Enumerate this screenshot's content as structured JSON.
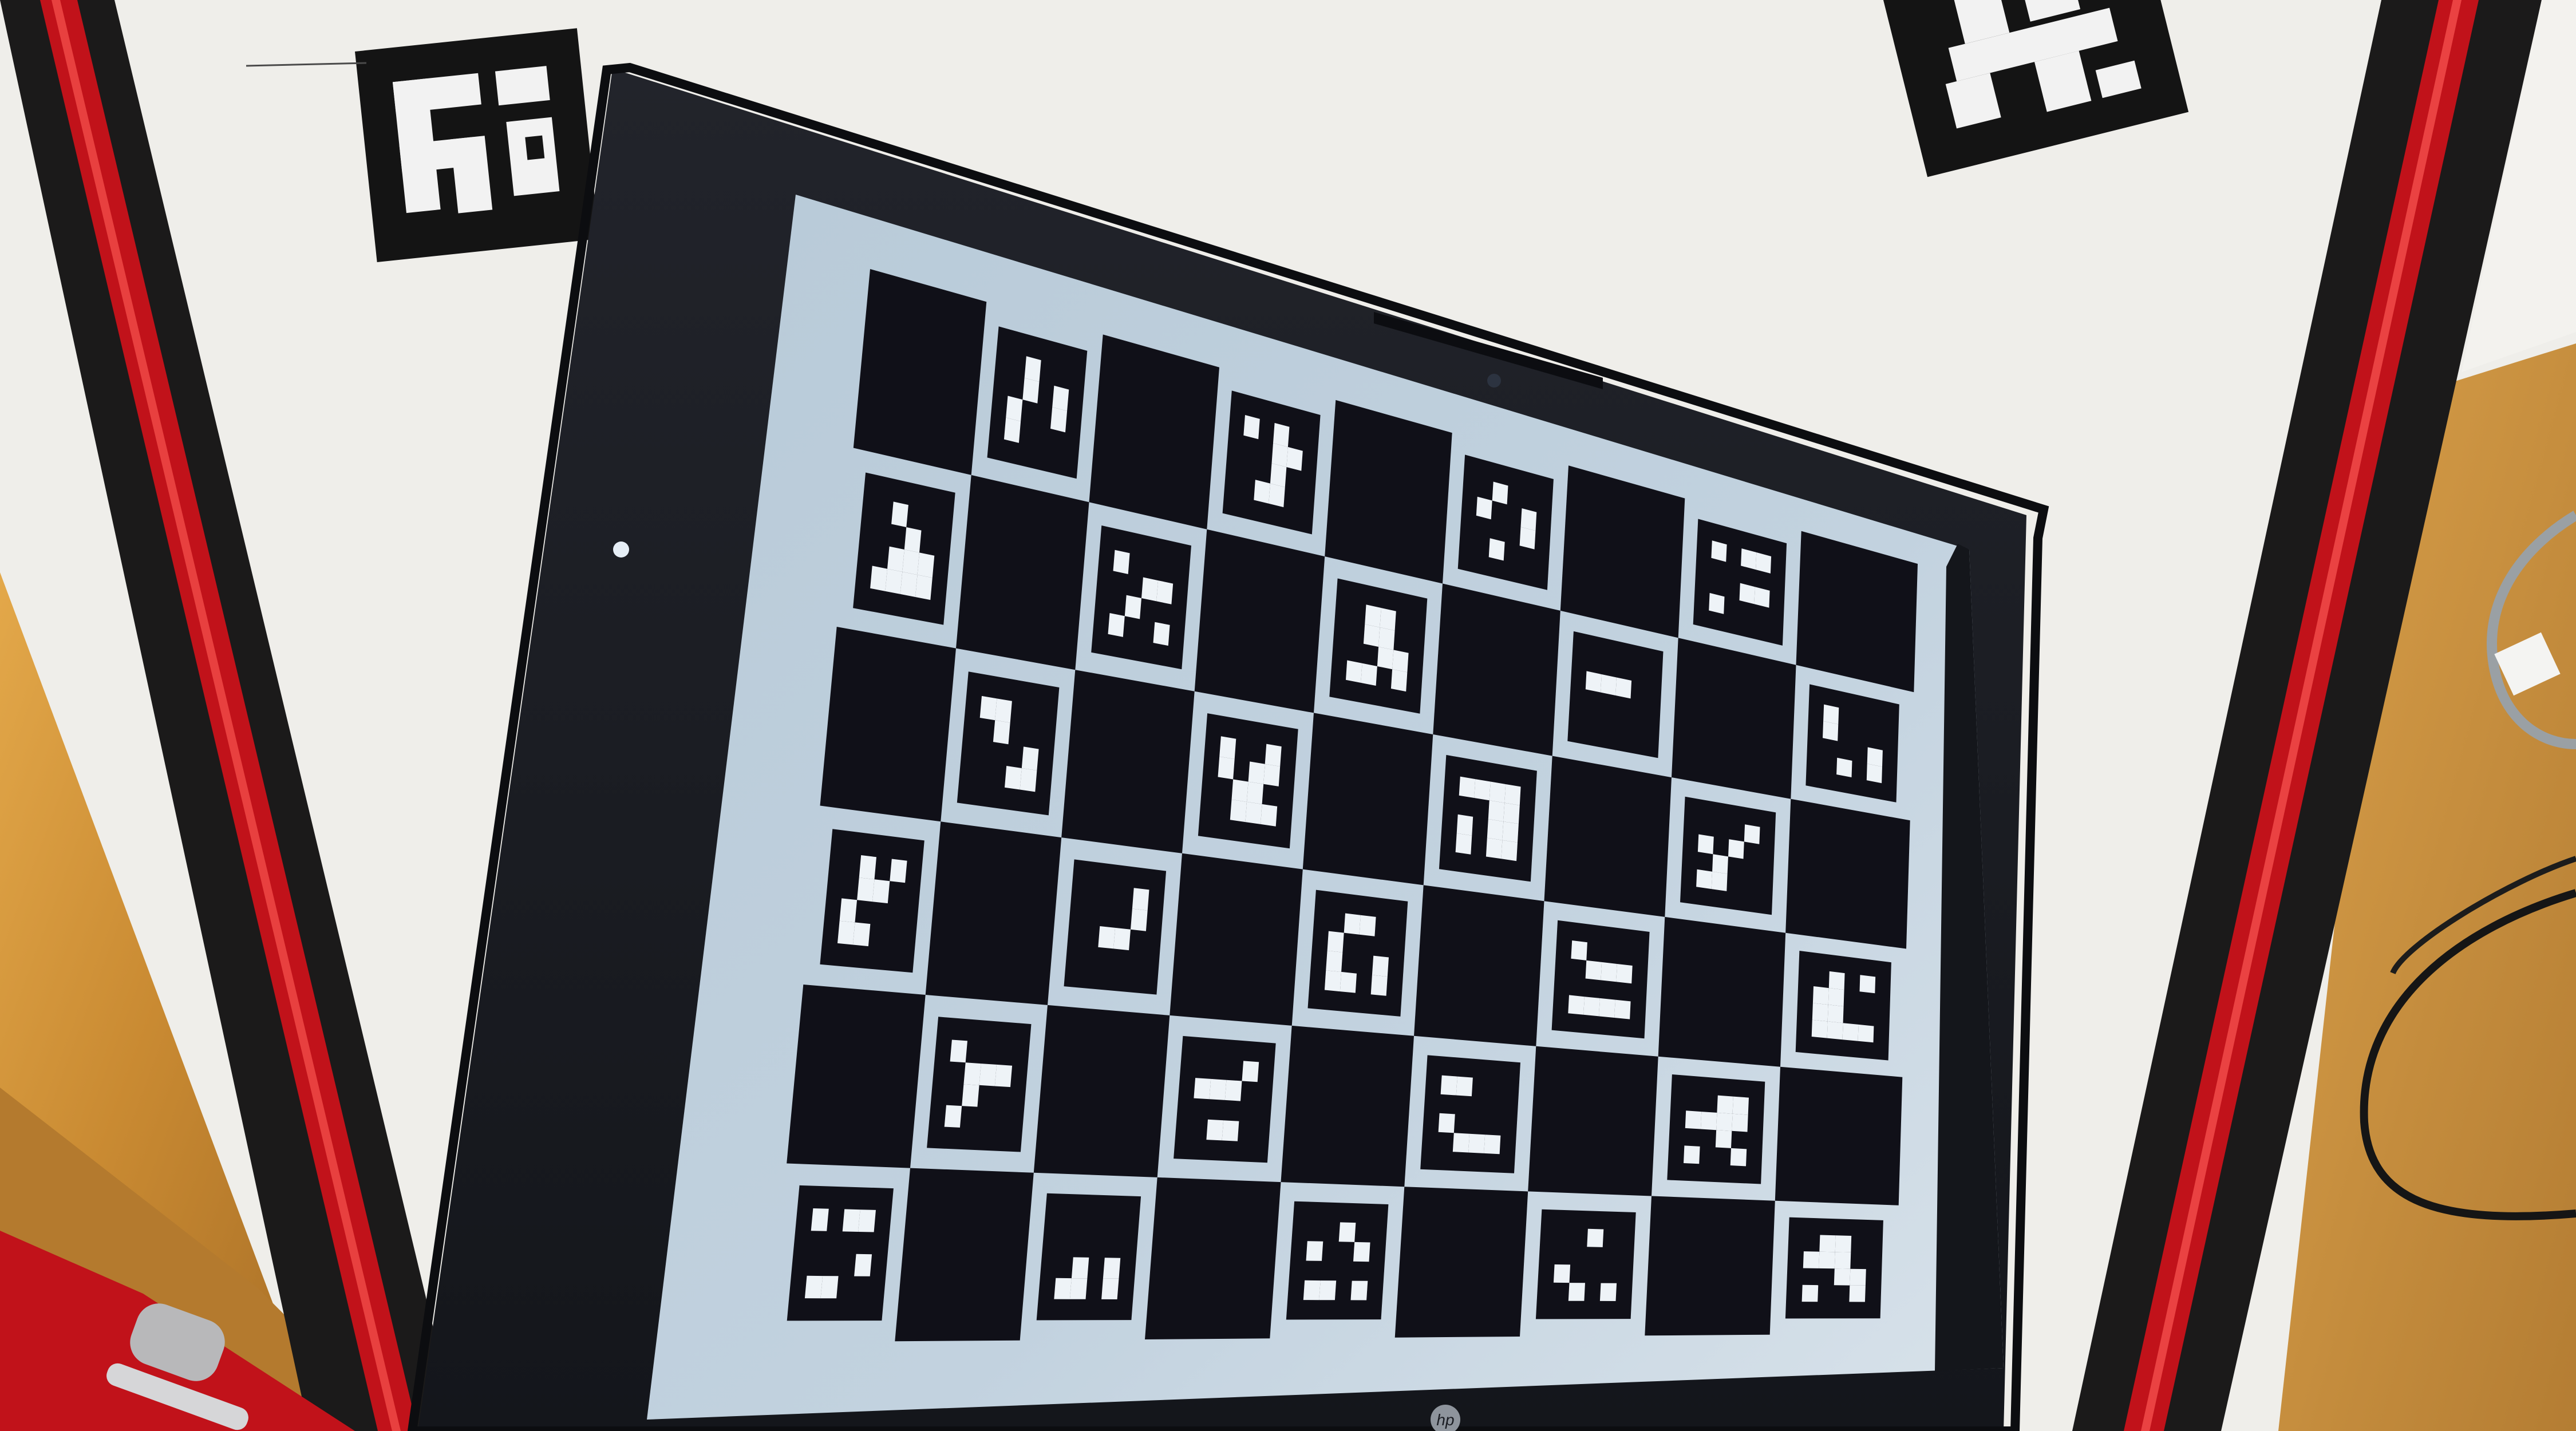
{
  "scene": {
    "description_label": "",
    "colors": {
      "table_wood": "#c98f3a",
      "white_board": "#efeeea",
      "red_rail": "#c1121a",
      "black_rail": "#1b1a1a",
      "laptop_bezel": "#1a1c22",
      "screen_light": "#b7c8d6",
      "charuco_dark": "#101018",
      "marker_white": "#eef3f7"
    },
    "laptop": {
      "brand_logo": "hp-logo"
    },
    "board": {
      "type": "charuco",
      "rows": 6,
      "cols": 9
    },
    "fiducials": {
      "count": 2,
      "type": "aruco"
    }
  }
}
